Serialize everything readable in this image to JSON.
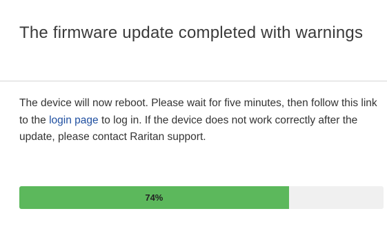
{
  "dialog": {
    "title": "The firmware update completed with warnings",
    "message": {
      "before_link": "The device will now reboot. Please wait for five minutes, then follow this link to the ",
      "link_text": "login page",
      "after_link": " to log in. If the device does not work correctly after the update, please contact Raritan support."
    },
    "progress": {
      "value": 74,
      "label": "74%",
      "fill_color": "#5cb85c",
      "track_color": "#f0f0f0"
    }
  },
  "colors": {
    "link": "#1f4fa0",
    "title": "#3a3a3a",
    "text": "#333333"
  }
}
